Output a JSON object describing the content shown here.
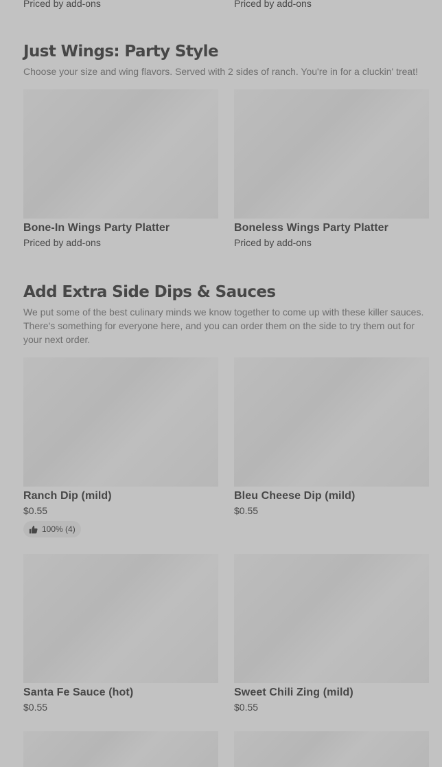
{
  "top_row": {
    "left_price": "Priced by add-ons",
    "right_price": "Priced by add-ons"
  },
  "wings": {
    "title": "Just Wings: Party Style",
    "description": "Choose your size and wing flavors. Served with 2 sides of ranch. You're in for a cluckin' treat!",
    "items": [
      {
        "name": "Bone-In Wings Party Platter",
        "price": "Priced by add-ons"
      },
      {
        "name": "Boneless Wings Party Platter",
        "price": "Priced by add-ons"
      }
    ]
  },
  "dips": {
    "title": "Add Extra Side Dips & Sauces",
    "description": "We put some of the best culinary minds we know together to come up with these killer sauces. There's something for everyone here, and you can order them on the side to try them out for your next order.",
    "items": [
      {
        "name": "Ranch Dip (mild)",
        "price": "$0.55",
        "rating": "100% (4)",
        "rating_icon": "thumbs-up-icon"
      },
      {
        "name": "Bleu Cheese Dip (mild)",
        "price": "$0.55"
      },
      {
        "name": "Santa Fe Sauce (hot)",
        "price": "$0.55"
      },
      {
        "name": "Sweet Chili Zing (mild)",
        "price": "$0.55"
      }
    ]
  }
}
